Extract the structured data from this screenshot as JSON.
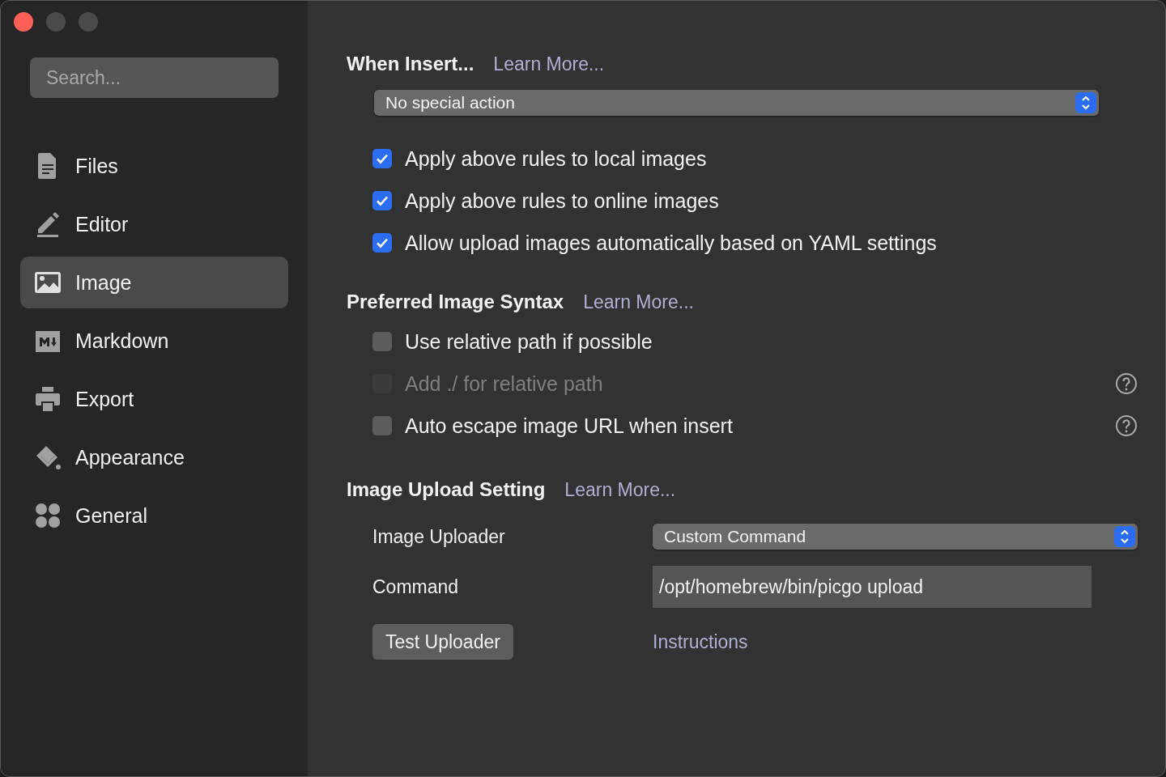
{
  "sidebar": {
    "search": {
      "placeholder": "Search..."
    },
    "items": [
      {
        "label": "Files",
        "kind": "files",
        "selected": false
      },
      {
        "label": "Editor",
        "kind": "editor",
        "selected": false
      },
      {
        "label": "Image",
        "kind": "image",
        "selected": true
      },
      {
        "label": "Markdown",
        "kind": "markdown",
        "selected": false
      },
      {
        "label": "Export",
        "kind": "export",
        "selected": false
      },
      {
        "label": "Appearance",
        "kind": "appearance",
        "selected": false
      },
      {
        "label": "General",
        "kind": "general",
        "selected": false
      }
    ]
  },
  "when_insert": {
    "title": "When Insert...",
    "link": "Learn More...",
    "select": {
      "value": "No special action"
    },
    "options": [
      {
        "label": "Apply above rules to local images",
        "checked": true,
        "disabled": false,
        "help": false
      },
      {
        "label": "Apply above rules to online images",
        "checked": true,
        "disabled": false,
        "help": false
      },
      {
        "label": "Allow upload images automatically based on YAML settings",
        "checked": true,
        "disabled": false,
        "help": false
      }
    ]
  },
  "image_syntax": {
    "title": "Preferred Image Syntax",
    "link": "Learn More...",
    "options": [
      {
        "label": "Use relative path if possible",
        "checked": false,
        "disabled": false,
        "help": false
      },
      {
        "label": "Add ./ for relative path",
        "checked": false,
        "disabled": true,
        "help": true
      },
      {
        "label": "Auto escape image URL when insert",
        "checked": false,
        "disabled": false,
        "help": true
      }
    ]
  },
  "upload": {
    "title": "Image Upload Setting",
    "link": "Learn More...",
    "uploader": {
      "label": "Image Uploader",
      "value": "Custom Command"
    },
    "command": {
      "label": "Command",
      "value": "/opt/homebrew/bin/picgo upload"
    },
    "test_button": "Test Uploader",
    "instructions_link": "Instructions"
  }
}
